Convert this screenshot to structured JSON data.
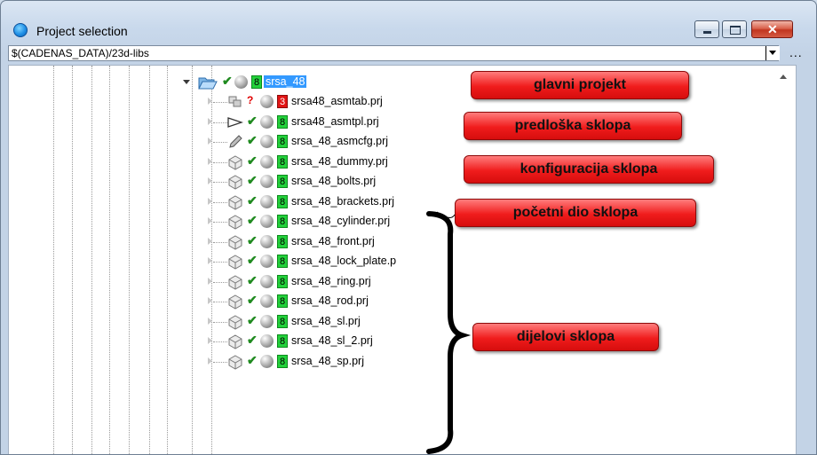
{
  "window": {
    "title": "Project selection"
  },
  "path": {
    "value": "$(CADENAS_DATA)/23d-libs",
    "more_label": "..."
  },
  "tree": {
    "root": {
      "label": "srsa_48",
      "badge": "8"
    },
    "items": [
      {
        "label": "srsa48_asmtab.prj",
        "badge": "3",
        "badge_color": "red",
        "status": "?",
        "icon": "assembly-table-icon"
      },
      {
        "label": "srsa48_asmtpl.prj",
        "badge": "8",
        "badge_color": "green",
        "status": "ok",
        "icon": "template-arrow-icon"
      },
      {
        "label": "srsa_48_asmcfg.prj",
        "badge": "8",
        "badge_color": "green",
        "status": "ok",
        "icon": "pencil-icon"
      },
      {
        "label": "srsa_48_dummy.prj",
        "badge": "8",
        "badge_color": "green",
        "status": "ok",
        "icon": "part-cube-icon"
      },
      {
        "label": "srsa_48_bolts.prj",
        "badge": "8",
        "badge_color": "green",
        "status": "ok",
        "icon": "part-cube-icon"
      },
      {
        "label": "srsa_48_brackets.prj",
        "badge": "8",
        "badge_color": "green",
        "status": "ok",
        "icon": "part-cube-icon"
      },
      {
        "label": "srsa_48_cylinder.prj",
        "badge": "8",
        "badge_color": "green",
        "status": "ok",
        "icon": "part-cube-icon"
      },
      {
        "label": "srsa_48_front.prj",
        "badge": "8",
        "badge_color": "green",
        "status": "ok",
        "icon": "part-cube-icon"
      },
      {
        "label": "srsa_48_lock_plate.p",
        "badge": "8",
        "badge_color": "green",
        "status": "ok",
        "icon": "part-cube-icon"
      },
      {
        "label": "srsa_48_ring.prj",
        "badge": "8",
        "badge_color": "green",
        "status": "ok",
        "icon": "part-cube-icon"
      },
      {
        "label": "srsa_48_rod.prj",
        "badge": "8",
        "badge_color": "green",
        "status": "ok",
        "icon": "part-cube-icon"
      },
      {
        "label": "srsa_48_sl.prj",
        "badge": "8",
        "badge_color": "green",
        "status": "ok",
        "icon": "part-cube-icon"
      },
      {
        "label": "srsa_48_sl_2.prj",
        "badge": "8",
        "badge_color": "green",
        "status": "ok",
        "icon": "part-cube-icon"
      },
      {
        "label": "srsa_48_sp.prj",
        "badge": "8",
        "badge_color": "green",
        "status": "ok",
        "icon": "part-cube-icon"
      }
    ]
  },
  "callouts": {
    "main_project": "glavni projekt",
    "assembly_template": "predloška sklopa",
    "assembly_config": "konfiguracija sklopa",
    "initial_part": "početni dio sklopa",
    "assembly_parts": "dijelovi sklopa"
  },
  "colors": {
    "callout": "#f01c1c",
    "badge_green": "#23d13b",
    "badge_red": "#e21414",
    "selection": "#3399ff"
  }
}
